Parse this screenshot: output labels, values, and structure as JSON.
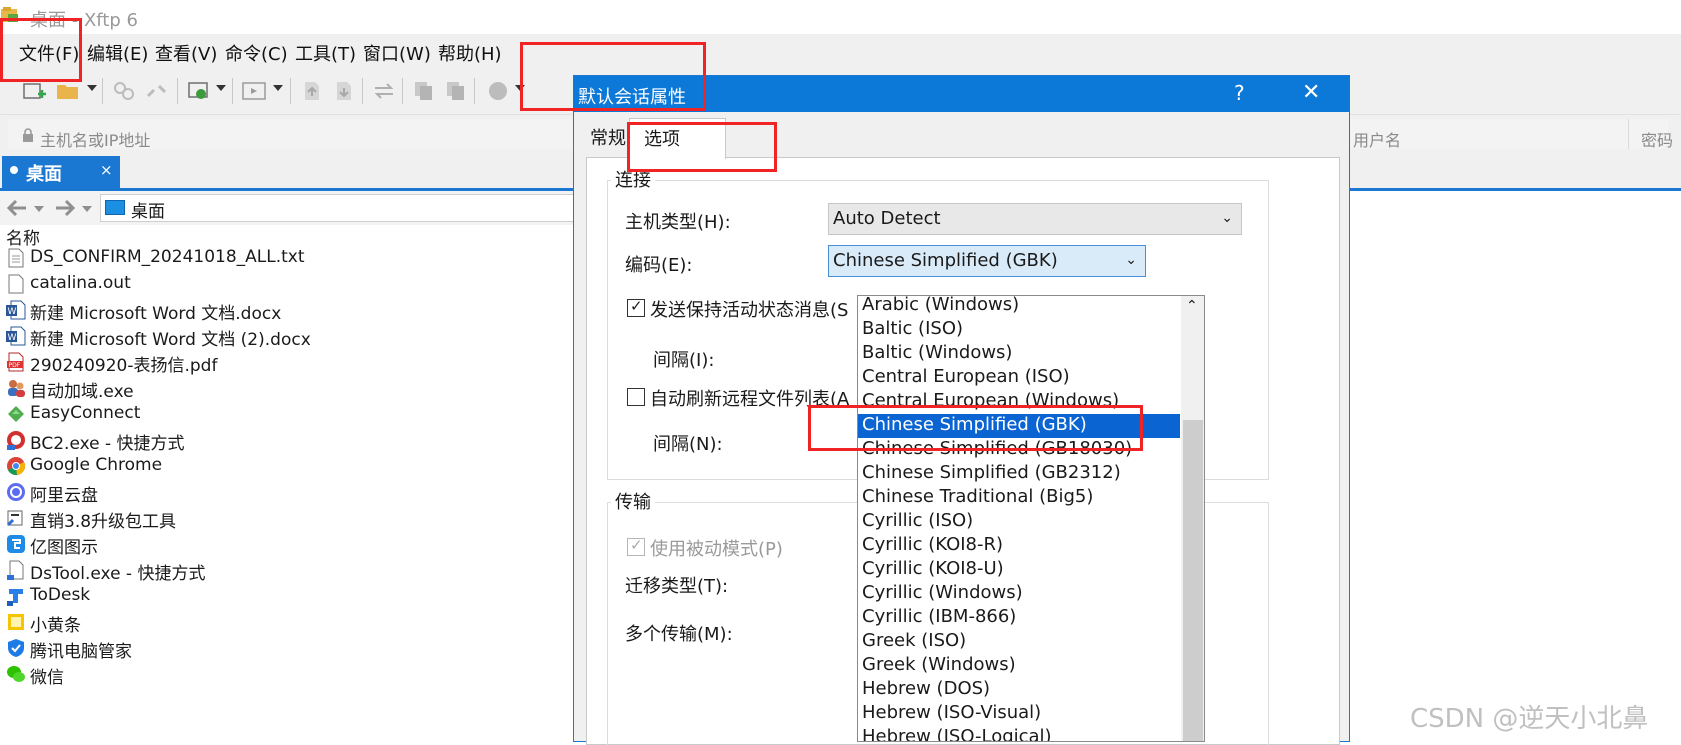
{
  "window": {
    "title": "桌面 - Xftp 6"
  },
  "menu": [
    "文件(F)",
    "编辑(E)",
    "查看(V)",
    "命令(C)",
    "工具(T)",
    "窗口(W)",
    "帮助(H)"
  ],
  "address_bar": {
    "host_placeholder": "主机名或IP地址",
    "user_placeholder": "用户名",
    "password_placeholder": "密码"
  },
  "local_tab": {
    "label": "桌面",
    "close": "×"
  },
  "nav": {
    "path": "桌面"
  },
  "file_list": {
    "header": "名称",
    "files": [
      {
        "name": "DS_CONFIRM_20241018_ALL.txt",
        "icon": "text-file-icon"
      },
      {
        "name": "catalina.out",
        "icon": "file-icon"
      },
      {
        "name": "新建 Microsoft Word 文档.docx",
        "icon": "word-icon"
      },
      {
        "name": "新建 Microsoft Word 文档 (2).docx",
        "icon": "word-icon"
      },
      {
        "name": "290240920-表扬信.pdf",
        "icon": "pdf-icon"
      },
      {
        "name": "自动加域.exe",
        "icon": "users-icon"
      },
      {
        "name": "EasyConnect",
        "icon": "easyconnect-icon"
      },
      {
        "name": "BC2.exe - 快捷方式",
        "icon": "bc2-icon"
      },
      {
        "name": "Google Chrome",
        "icon": "chrome-icon"
      },
      {
        "name": "阿里云盘",
        "icon": "aliyun-drive-icon"
      },
      {
        "name": "直销3.8升级包工具",
        "icon": "tool-icon"
      },
      {
        "name": "亿图图示",
        "icon": "edraw-icon"
      },
      {
        "name": "DsTool.exe - 快捷方式",
        "icon": "dstool-icon"
      },
      {
        "name": "ToDesk",
        "icon": "todesk-icon"
      },
      {
        "name": "小黄条",
        "icon": "sticky-note-icon"
      },
      {
        "name": "腾讯电脑管家",
        "icon": "tencent-guard-icon"
      },
      {
        "name": "微信",
        "icon": "wechat-icon"
      }
    ]
  },
  "dialog": {
    "title": "默认会话属性",
    "help": "?",
    "close": "✕",
    "tabs": [
      "常规",
      "选项"
    ],
    "connection": {
      "title": "连接",
      "host_type_label": "主机类型(H):",
      "host_type_value": "Auto Detect",
      "encoding_label": "编码(E):",
      "encoding_value": "Chinese Simplified (GBK)",
      "keepalive_label": "发送保持活动状态消息(S",
      "keepalive_checked": true,
      "interval1_label": "间隔(I):",
      "autorefresh_label": "自动刷新远程文件列表(A",
      "autorefresh_checked": false,
      "interval2_label": "间隔(N):"
    },
    "transfer": {
      "title": "传输",
      "passive_label": "使用被动模式(P)",
      "passive_checked": true,
      "migrate_label": "迁移类型(T):",
      "multi_label": "多个传输(M):"
    }
  },
  "encoding_options": {
    "items": [
      "Arabic (Windows)",
      "Baltic (ISO)",
      "Baltic (Windows)",
      "Central European (ISO)",
      "Central European (Windows)",
      "Chinese Simplified (GBK)",
      "Chinese Simplified (GB18030)",
      "Chinese Simplified (GB2312)",
      "Chinese Traditional (Big5)",
      "Cyrillic (ISO)",
      "Cyrillic (KOI8-R)",
      "Cyrillic (KOI8-U)",
      "Cyrillic (Windows)",
      "Cyrillic (IBM-866)",
      "Greek (ISO)",
      "Greek (Windows)",
      "Hebrew (DOS)",
      "Hebrew (ISO-Visual)",
      "Hebrew (ISO-Logical)"
    ],
    "selected_index": 5
  },
  "watermark": "CSDN @逆天小北鼻",
  "colors": {
    "accent": "#0c78d8",
    "selection": "#0a64d2",
    "annotation": "#f02424"
  }
}
